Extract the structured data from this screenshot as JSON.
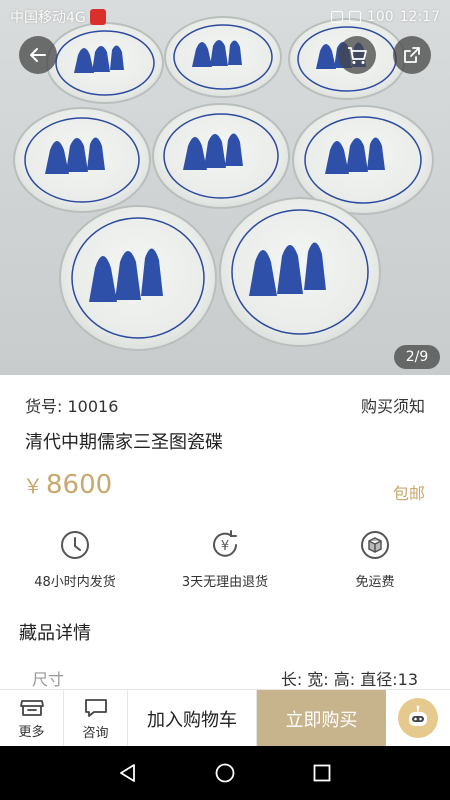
{
  "status_bar": {
    "carrier": "中国移动4G",
    "battery": "100",
    "time": "12:17"
  },
  "gallery": {
    "page_indicator": "2/9"
  },
  "product": {
    "sku_label": "货号: 10016",
    "purchase_notice": "购买须知",
    "title": "清代中期儒家三圣图瓷碟",
    "currency": "￥",
    "price": "8600",
    "shipping": "包邮"
  },
  "services": [
    {
      "icon": "clock-icon",
      "label": "48小时内发货"
    },
    {
      "icon": "yuan-return-icon",
      "label": "3天无理由退货"
    },
    {
      "icon": "box-icon",
      "label": "免运费"
    }
  ],
  "details": {
    "section_title": "藏品详情",
    "size_key": "尺寸",
    "size_value": "长: 宽: 高: 直径:13"
  },
  "action_bar": {
    "more_label": "更多",
    "consult_label": "咨询",
    "add_to_cart_label": "加入购物车",
    "buy_now_label": "立即购买"
  },
  "colors": {
    "accent_gold": "#c8a86e",
    "buy_button": "#c8b48c"
  }
}
